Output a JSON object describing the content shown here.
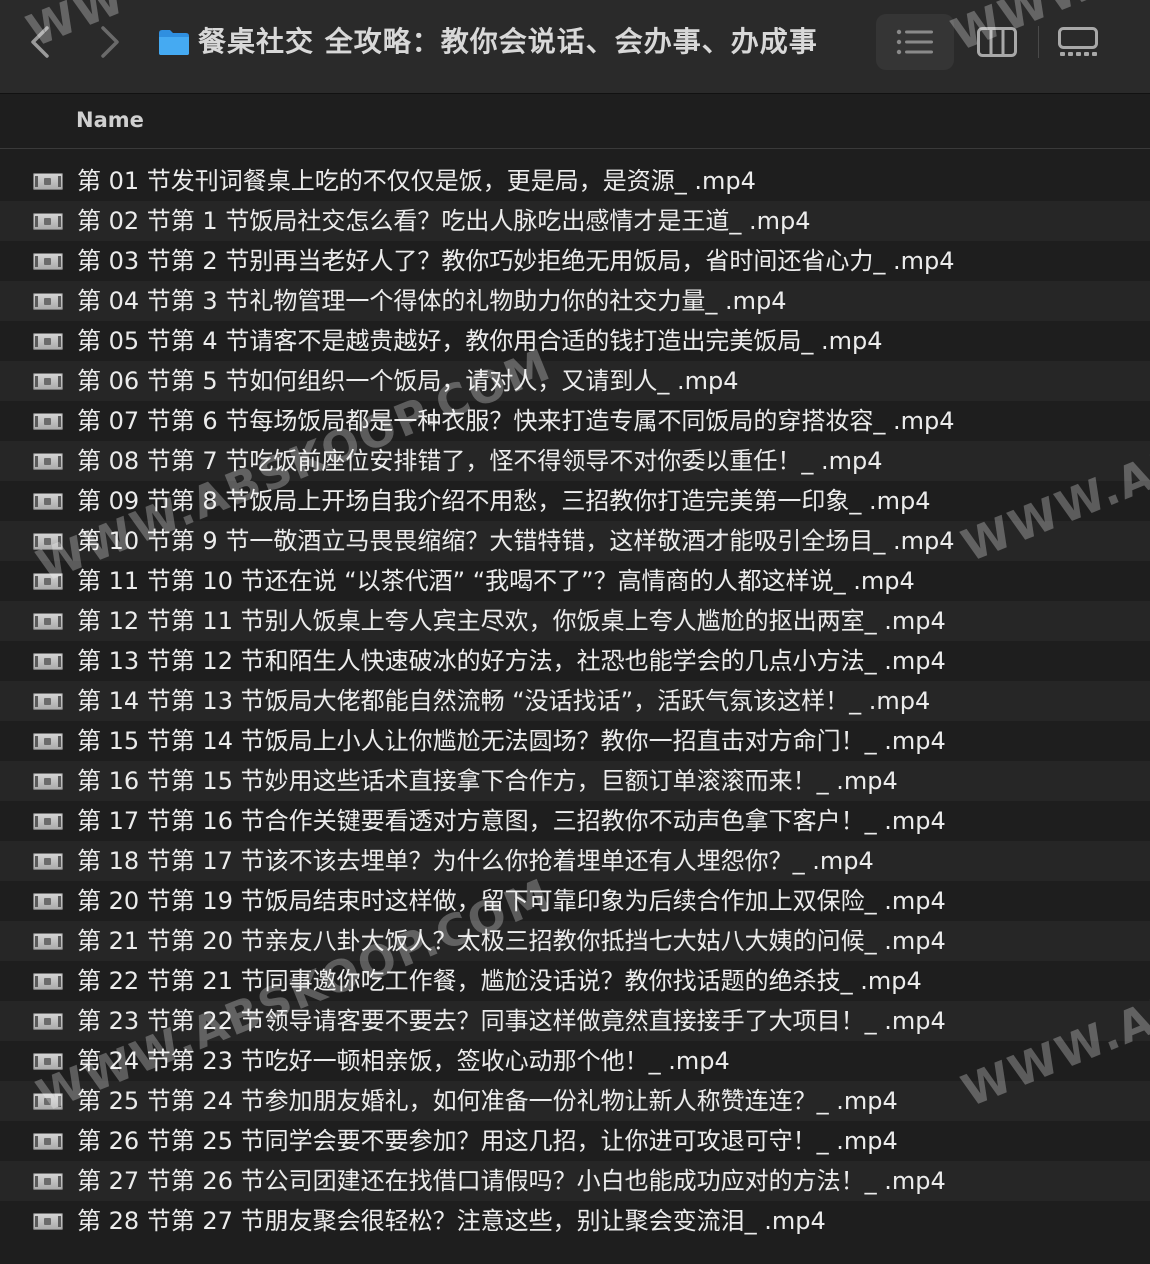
{
  "window": {
    "title": "餐桌社交 全攻略：教你会说话、会办事、办成事",
    "folder_icon": "folder-icon",
    "accent": "#3aa0f0"
  },
  "toolbar": {
    "back_icon": "chevron-left-icon",
    "forward_icon": "chevron-right-icon",
    "view_icons": [
      "list-view-icon",
      "column-view-icon",
      "gallery-view-icon"
    ]
  },
  "header": {
    "name_label": "Name"
  },
  "files": [
    "第 01 节发刊词餐桌上吃的不仅仅是饭，更是局，是资源_ .mp4",
    "第 02 节第 1 节饭局社交怎么看？吃出人脉吃出感情才是王道_ .mp4",
    "第 03 节第 2 节别再当老好人了？教你巧妙拒绝无用饭局，省时间还省心力_ .mp4",
    "第 04 节第 3 节礼物管理一个得体的礼物助力你的社交力量_ .mp4",
    "第 05 节第 4 节请客不是越贵越好，教你用合适的钱打造出完美饭局_ .mp4",
    "第 06 节第 5 节如何组织一个饭局，请对人，又请到人_ .mp4",
    "第 07 节第 6 节每场饭局都是一种衣服？快来打造专属不同饭局的穿搭妆容_ .mp4",
    "第 08 节第 7 节吃饭前座位安排错了，怪不得领导不对你委以重任！_ .mp4",
    "第 09 节第 8 节饭局上开场自我介绍不用愁，三招教你打造完美第一印象_ .mp4",
    "第 10 节第 9 节一敬酒立马畏畏缩缩？大错特错，这样敬酒才能吸引全场目_ .mp4",
    "第 11 节第 10 节还在说 “以茶代酒” “我喝不了”？高情商的人都这样说_ .mp4",
    "第 12 节第 11 节别人饭桌上夸人宾主尽欢，你饭桌上夸人尴尬的抠出两室_ .mp4",
    "第 13 节第 12 节和陌生人快速破冰的好方法，社恐也能学会的几点小方法_ .mp4",
    "第 14 节第 13 节饭局大佬都能自然流畅 “没话找话”，活跃气氛该这样！_ .mp4",
    "第 15 节第 14 节饭局上小人让你尴尬无法圆场？教你一招直击对方命门！_ .mp4",
    "第 16 节第 15 节妙用这些话术直接拿下合作方，巨额订单滚滚而来！_ .mp4",
    "第 17 节第 16 节合作关键要看透对方意图，三招教你不动声色拿下客户！_ .mp4",
    "第 18 节第 17 节该不该去埋单？为什么你抢着埋单还有人埋怨你？_ .mp4",
    "第 20 节第 19 节饭局结束时这样做，留下可靠印象为后续合作加上双保险_ .mp4",
    "第 21 节第 20 节亲友八卦大饭人？太极三招教你抵挡七大姑八大姨的问候_ .mp4",
    "第 22 节第 21 节同事邀你吃工作餐，尴尬没话说？教你找话题的绝杀技_ .mp4",
    "第 23 节第 22 节领导请客要不要去？同事这样做竟然直接接手了大项目！_ .mp4",
    "第 24 节第 23 节吃好一顿相亲饭，签收心动那个他！_ .mp4",
    "第 25 节第 24 节参加朋友婚礼，如何准备一份礼物让新人称赞连连？_ .mp4",
    "第 26 节第 25 节同学会要不要参加？用这几招，让你进可攻退可守！_ .mp4",
    "第 27 节第 26 节公司团建还在找借口请假吗？小白也能成功应对的方法！_ .mp4",
    "第 28 节第 27 节朋友聚会很轻松？注意这些，别让聚会变流泪_ .mp4"
  ],
  "watermark": {
    "text_left": "WWW.ABSKOOP.COM",
    "text_right": "WWW.ABS",
    "text_top_left": "WW",
    "text_top_right": "WWW"
  }
}
